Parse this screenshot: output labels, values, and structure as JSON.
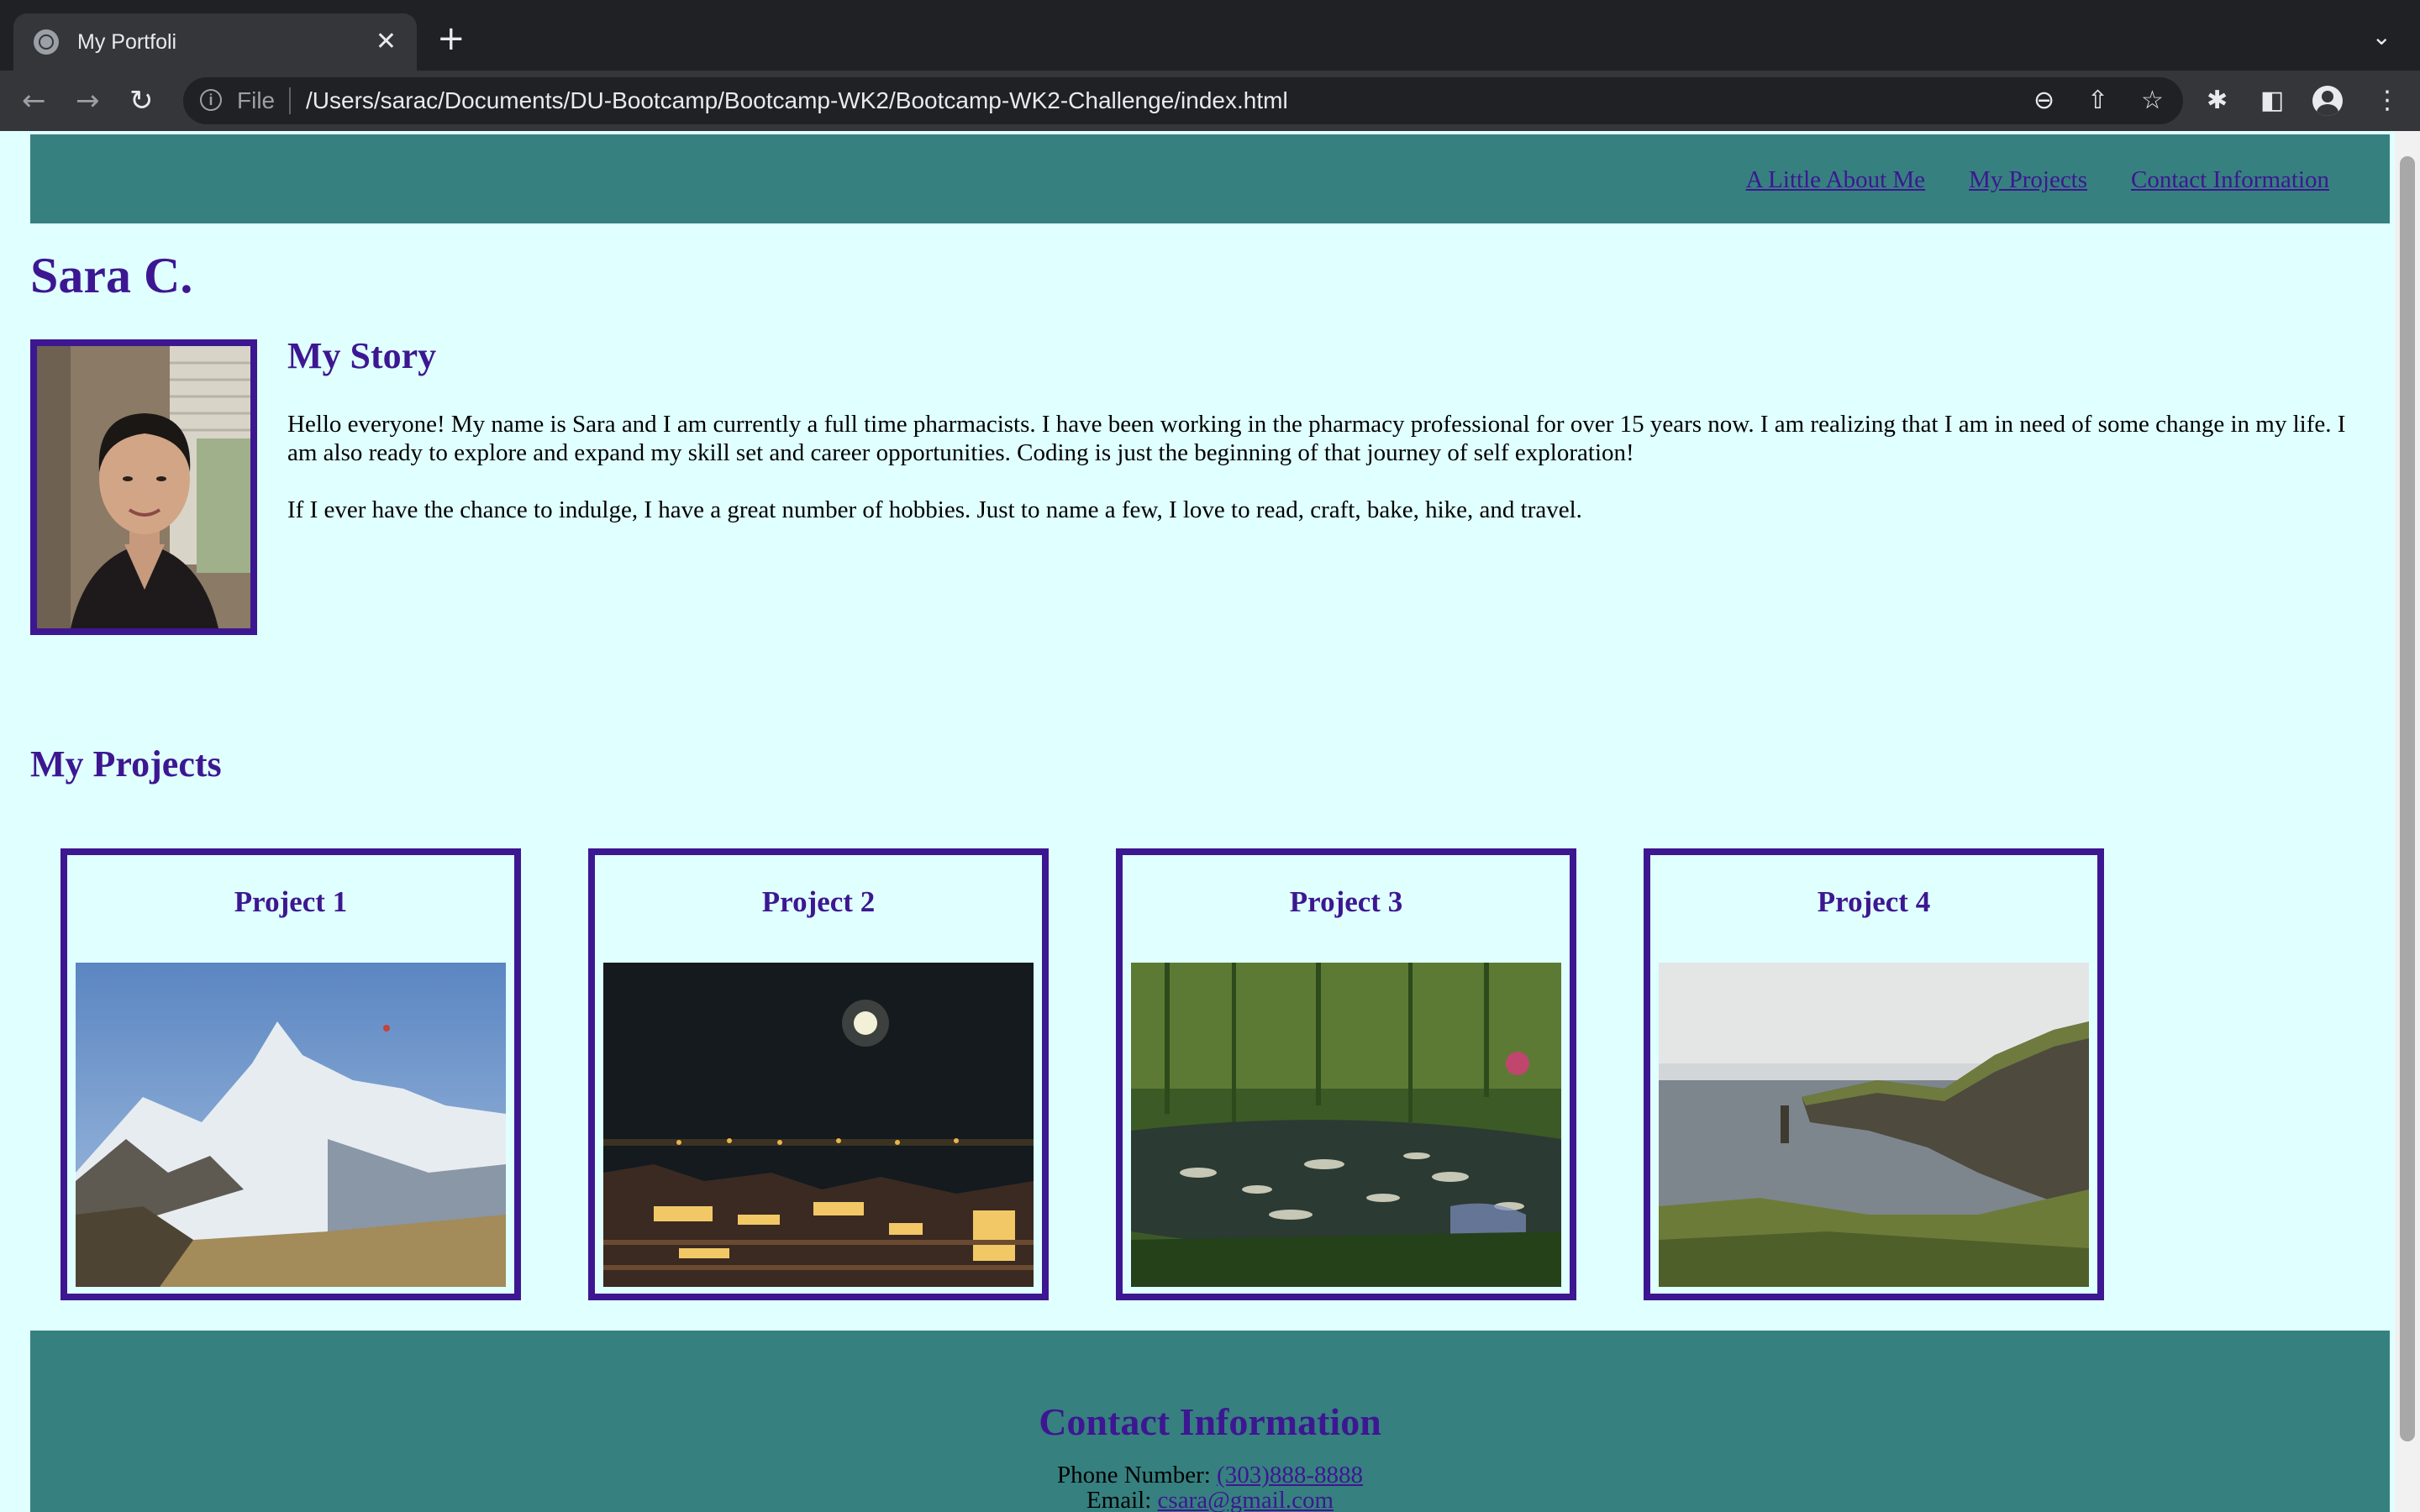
{
  "browser": {
    "tab_title": "My Portfoli",
    "close_glyph": "✕",
    "new_tab_glyph": "+",
    "tab_menu_glyph": "⌄",
    "back_glyph": "←",
    "forward_glyph": "→",
    "reload_glyph": "↻",
    "info_glyph": "i",
    "scheme_label": "File",
    "url": "/Users/sarac/Documents/DU-Bootcamp/Bootcamp-WK2/Bootcamp-WK2-Challenge/index.html",
    "zoom_glyph": "⊖",
    "share_glyph": "⇧",
    "bookmark_glyph": "☆",
    "extensions_glyph": "✱",
    "sidepanel_glyph": "◧",
    "menu_glyph": "⋮"
  },
  "header": {
    "nav": [
      "A Little About Me",
      "My Projects",
      "Contact Information"
    ]
  },
  "site_name": "Sara C.",
  "about": {
    "heading": "My Story",
    "paragraphs": [
      "Hello everyone! My name is Sara and I am currently a full time pharmacists. I have been working in the pharmacy professional for over 15 years now. I am realizing that I am in need of some change in my life. I am also ready to explore and expand my skill set and career opportunities. Coding is just the beginning of that journey of self exploration!",
      "If I ever have the chance to indulge, I have a great number of hobbies. Just to name a few, I love to read, craft, bake, hike, and travel."
    ]
  },
  "projects": {
    "heading": "My Projects",
    "items": [
      {
        "title": "Project 1"
      },
      {
        "title": "Project 2"
      },
      {
        "title": "Project 3"
      },
      {
        "title": "Project 4"
      }
    ]
  },
  "contact": {
    "heading": "Contact Information",
    "phone_label": "Phone Number: ",
    "phone": "(303)888-8888",
    "email_label": "Email: ",
    "email": "csara@gmail.com"
  },
  "colors": {
    "header_bg": "#368080",
    "page_bg": "#e0ffff",
    "accent": "#3d1791"
  },
  "icons": [
    "globe-icon",
    "close-icon",
    "plus-icon",
    "chevron-down-icon",
    "back-arrow-icon",
    "forward-arrow-icon",
    "reload-icon",
    "info-icon",
    "zoom-icon",
    "share-icon",
    "star-icon",
    "puzzle-icon",
    "side-panel-icon",
    "profile-icon",
    "kebab-menu-icon"
  ]
}
